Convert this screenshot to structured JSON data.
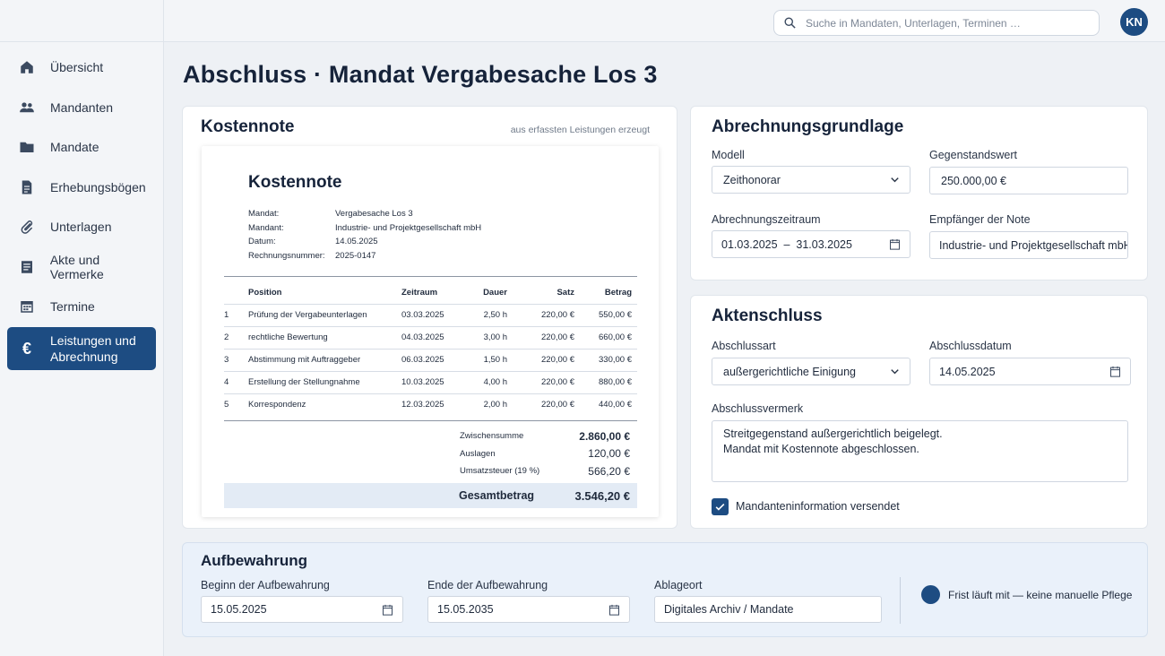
{
  "sidebar": {
    "items": [
      {
        "label": "Übersicht",
        "icon": "home-icon"
      },
      {
        "label": "Mandanten",
        "icon": "people-icon"
      },
      {
        "label": "Mandate",
        "icon": "folder-icon"
      },
      {
        "label": "Erhebungsbögen",
        "icon": "document-icon"
      },
      {
        "label": "Unterlagen",
        "icon": "paperclip-icon"
      },
      {
        "label": "Akte und Vermerke",
        "icon": "notes-icon"
      },
      {
        "label": "Termine",
        "icon": "calendar-icon"
      },
      {
        "label": "Leistungen und Abrechnung",
        "icon": "euro-icon",
        "active": true
      }
    ]
  },
  "topbar": {
    "search_placeholder": "Suche in Mandaten, Unterlagen, Terminen …",
    "avatar_initials": "KN"
  },
  "page": {
    "title": "Abschluss · Mandat Vergabesache Los 3"
  },
  "kostennote": {
    "heading": "Kostennote",
    "subtitle": "aus erfassten Leistungen erzeugt",
    "doc": {
      "title": "Kostennote",
      "meta": [
        {
          "key": "Mandat:",
          "value": "Vergabesache Los 3"
        },
        {
          "key": "Mandant:",
          "value": "Industrie- und Projektgesellschaft mbH"
        },
        {
          "key": "Datum:",
          "value": "14.05.2025"
        },
        {
          "key": "Rechnungsnummer:",
          "value": "2025-0147"
        }
      ],
      "columns": {
        "position": "Position",
        "zeitraum": "Zeitraum",
        "dauer": "Dauer",
        "satz": "Satz",
        "betrag": "Betrag"
      },
      "rows": [
        {
          "no": "1",
          "position": "Prüfung der Vergabeunterlagen",
          "zeitraum": "03.03.2025",
          "dauer": "2,50 h",
          "satz": "220,00 €",
          "betrag": "550,00 €"
        },
        {
          "no": "2",
          "position": "rechtliche Bewertung",
          "zeitraum": "04.03.2025",
          "dauer": "3,00 h",
          "satz": "220,00 €",
          "betrag": "660,00 €"
        },
        {
          "no": "3",
          "position": "Abstimmung mit Auftraggeber",
          "zeitraum": "06.03.2025",
          "dauer": "1,50 h",
          "satz": "220,00 €",
          "betrag": "330,00 €"
        },
        {
          "no": "4",
          "position": "Erstellung der Stellungnahme",
          "zeitraum": "10.03.2025",
          "dauer": "4,00 h",
          "satz": "220,00 €",
          "betrag": "880,00 €"
        },
        {
          "no": "5",
          "position": "Korrespondenz",
          "zeitraum": "12.03.2025",
          "dauer": "2,00 h",
          "satz": "220,00 €",
          "betrag": "440,00 €"
        }
      ],
      "sums": [
        {
          "label": "Zwischensumme",
          "value": "2.860,00 €"
        },
        {
          "label": "Auslagen",
          "value": "120,00 €"
        },
        {
          "label": "Umsatzsteuer (19 %)",
          "value": "566,20 €"
        }
      ],
      "total_label": "Gesamtbetrag",
      "total_value": "3.546,20 €"
    }
  },
  "abrechnungsgrundlage": {
    "heading": "Abrechnungsgrundlage",
    "modell_label": "Modell",
    "modell_value": "Zeithonorar",
    "gegenstandswert_label": "Gegenstandswert",
    "gegenstandswert_value": "250.000,00 €",
    "zeitraum_label": "Abrechnungszeitraum",
    "zeitraum_value": "01.03.2025  –  31.03.2025",
    "empfaenger_label": "Empfänger der Note",
    "empfaenger_value": "Industrie- und Projektgesellschaft mbH"
  },
  "aktenschluss": {
    "heading": "Aktenschluss",
    "art_label": "Abschlussart",
    "art_value": "außergerichtliche Einigung",
    "datum_label": "Abschlussdatum",
    "datum_value": "14.05.2025",
    "vermerk_label": "Abschlussvermerk",
    "vermerk_line1": "Streitgegenstand außergerichtlich beigelegt.",
    "vermerk_line2": "Mandat mit Kostennote abgeschlossen.",
    "checkbox_label": "Mandanteninformation versendet",
    "checkbox_checked": true
  },
  "aufbewahrung": {
    "heading": "Aufbewahrung",
    "beginn_label": "Beginn der Aufbewahrung",
    "beginn_value": "15.05.2025",
    "ende_label": "Ende der Aufbewahrung",
    "ende_value": "15.05.2035",
    "ablageort_label": "Ablageort",
    "ablageort_value": "Digitales Archiv / Mandate",
    "frist_label": "Frist läuft mit — keine manuelle Pflege"
  },
  "colors": {
    "accent": "#1d4c82",
    "background": "#eef1f5"
  }
}
